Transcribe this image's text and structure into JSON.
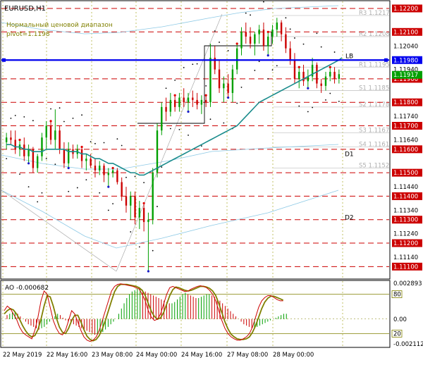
{
  "window": {
    "symbol_title": "EURUSD,H1",
    "indicator_title": "Нормальный ценовой диапазон",
    "pivot_label": "pivot=1.1198"
  },
  "price_axis": {
    "labels": [
      "1.12200",
      "1.12100",
      "1.12040",
      "1.11980",
      "1.11940",
      "1.11900",
      "1.11800",
      "1.11740",
      "1.11700",
      "1.11640",
      "1.11600",
      "1.11500",
      "1.11440",
      "1.11400",
      "1.11340",
      "1.11300",
      "1.11240",
      "1.11200",
      "1.11140",
      "1.11100"
    ],
    "current_price_label": "1.11917",
    "range": [
      1.1105,
      1.1223
    ]
  },
  "levels": [
    {
      "price": 1.122,
      "label": "1.12200"
    },
    {
      "price": 1.121,
      "label": "1.12100"
    },
    {
      "price": 1.119,
      "label": "1.11900"
    },
    {
      "price": 1.118,
      "label": "1.11800"
    },
    {
      "price": 1.117,
      "label": "1.11700"
    },
    {
      "price": 1.116,
      "label": "1.11600"
    },
    {
      "price": 1.115,
      "label": "1.11500"
    },
    {
      "price": 1.114,
      "label": "1.11400"
    },
    {
      "price": 1.113,
      "label": "1.11300"
    },
    {
      "price": 1.112,
      "label": "1.11200"
    },
    {
      "price": 1.111,
      "label": "1.11100"
    }
  ],
  "pivot_line": {
    "price": 1.1198,
    "label": "LB",
    "axis_label": "1.11980"
  },
  "pivot_levels": [
    {
      "name": "R3",
      "label": "R3 1.1217",
      "price": 1.1217
    },
    {
      "name": "R2",
      "label": "R2 1.1208",
      "price": 1.1208
    },
    {
      "name": "R1",
      "label": "R1 1.1195",
      "price": 1.1195
    },
    {
      "name": "S1",
      "label": "S1 1.1185",
      "price": 1.1185
    },
    {
      "name": "S2",
      "label": "S2 1.1178",
      "price": 1.1178
    },
    {
      "name": "S3",
      "label": "S3 1.1167",
      "price": 1.1167
    },
    {
      "name": "S4",
      "label": "S4 1.1161",
      "price": 1.1161
    },
    {
      "name": "S5",
      "label": "S5 1.1152",
      "price": 1.1152
    }
  ],
  "annotations": [
    {
      "label": "D1",
      "price": 1.1158
    },
    {
      "label": "D2",
      "price": 1.1131
    }
  ],
  "time_axis": {
    "labels": [
      "22 May 2019",
      "22 May 16:00",
      "23 May 08:00",
      "24 May 00:00",
      "24 May 16:00",
      "27 May 08:00",
      "28 May 00:00"
    ]
  },
  "oscillator": {
    "title": "AO -0.000682",
    "axis_labels": [
      "0.002893",
      "80",
      "0.00",
      "20",
      "-0.002112"
    ],
    "range": [
      -0.002112,
      0.002893
    ],
    "values": [
      0.0003,
      0.0004,
      0.0005,
      0.0006,
      0.0004,
      0.0002,
      0.0,
      -0.0002,
      -0.0004,
      -0.0005,
      -0.0006,
      -0.0007,
      -0.0008,
      -0.0007,
      -0.0006,
      -0.0004,
      -0.0002,
      0.0,
      0.0002,
      0.0004,
      0.0003,
      0.0001,
      -0.0001,
      -0.0002,
      -0.0003,
      -0.0004,
      -0.0005,
      -0.0006,
      -0.0007,
      -0.0008,
      -0.0009,
      -0.001,
      -0.0011,
      -0.0012,
      -0.0012,
      -0.0011,
      -0.001,
      -0.0008,
      -0.0006,
      -0.0004,
      -0.0002,
      0.0,
      0.0004,
      0.0008,
      0.0012,
      0.0016,
      0.0019,
      0.0021,
      0.0022,
      0.0023,
      0.0023,
      0.0022,
      0.0021,
      0.002,
      0.0019,
      0.0018,
      0.0017,
      0.0016,
      0.0015,
      0.0014,
      0.0013,
      0.0012,
      0.0012,
      0.0013,
      0.0015,
      0.0017,
      0.0019,
      0.002,
      0.0019,
      0.0018,
      0.0017,
      0.0016,
      0.0016,
      0.0017,
      0.0018,
      0.0019,
      0.0019,
      0.0018,
      0.0017,
      0.0016,
      0.0014,
      0.0012,
      0.001,
      0.0008,
      0.0006,
      0.0004,
      0.0002,
      0.0,
      -0.0002,
      -0.0004,
      -0.0005,
      -0.0006,
      -0.0007,
      -0.0007,
      -0.0006,
      -0.0005,
      -0.0004,
      -0.0003,
      -0.0002,
      -0.0001,
      0.0,
      0.0001,
      0.0002,
      0.0003,
      0.0004,
      0.0004
    ],
    "stoch_k": [
      55,
      62,
      58,
      50,
      42,
      30,
      22,
      18,
      15,
      12,
      25,
      45,
      70,
      85,
      80,
      60,
      40,
      28,
      20,
      18,
      25,
      40,
      55,
      50,
      38,
      25,
      15,
      10,
      8,
      10,
      15,
      25,
      40,
      55,
      70,
      85,
      92,
      95,
      96,
      95,
      94,
      93,
      92,
      90,
      88,
      80,
      70,
      55,
      45,
      40,
      42,
      50,
      65,
      80,
      90,
      92,
      90,
      88,
      86,
      84,
      85,
      88,
      90,
      92,
      93,
      92,
      90,
      86,
      80,
      70,
      55,
      40,
      28,
      20,
      15,
      12,
      10,
      10,
      12,
      15,
      20,
      30,
      45,
      60,
      70,
      75,
      78,
      78,
      75,
      72,
      70,
      70
    ],
    "stoch_d": [
      50,
      55,
      58,
      56,
      50,
      42,
      32,
      24,
      18,
      15,
      17,
      26,
      42,
      62,
      78,
      76,
      62,
      44,
      30,
      22,
      20,
      28,
      40,
      48,
      48,
      38,
      26,
      16,
      11,
      9,
      11,
      17,
      27,
      40,
      55,
      70,
      84,
      92,
      95,
      95,
      95,
      94,
      93,
      92,
      90,
      86,
      78,
      66,
      54,
      46,
      42,
      44,
      52,
      65,
      78,
      87,
      91,
      90,
      88,
      86,
      85,
      86,
      88,
      90,
      92,
      92,
      91,
      89,
      85,
      78,
      66,
      52,
      38,
      27,
      19,
      15,
      12,
      11,
      11,
      12,
      15,
      22,
      32,
      45,
      58,
      68,
      74,
      77,
      77,
      75,
      73,
      71
    ]
  },
  "price_series": {
    "candles": [
      [
        1.1163,
        1.1167,
        1.116,
        1.1165
      ],
      [
        1.1165,
        1.1168,
        1.1162,
        1.1164
      ],
      [
        1.1164,
        1.1168,
        1.1158,
        1.116
      ],
      [
        1.116,
        1.1164,
        1.1157,
        1.1162
      ],
      [
        1.1162,
        1.1165,
        1.1155,
        1.1157
      ],
      [
        1.1157,
        1.1162,
        1.1154,
        1.116
      ],
      [
        1.116,
        1.1161,
        1.115,
        1.1152
      ],
      [
        1.1152,
        1.1158,
        1.115,
        1.1157
      ],
      [
        1.1157,
        1.1167,
        1.1155,
        1.1165
      ],
      [
        1.1165,
        1.1172,
        1.116,
        1.117
      ],
      [
        1.117,
        1.1172,
        1.1162,
        1.1164
      ],
      [
        1.1164,
        1.1177,
        1.116,
        1.1168
      ],
      [
        1.1168,
        1.117,
        1.1158,
        1.116
      ],
      [
        1.116,
        1.1163,
        1.1152,
        1.1154
      ],
      [
        1.1154,
        1.1163,
        1.1152,
        1.116
      ],
      [
        1.116,
        1.1162,
        1.1156,
        1.1158
      ],
      [
        1.1158,
        1.1162,
        1.1156,
        1.116
      ],
      [
        1.116,
        1.1161,
        1.1152,
        1.1155
      ],
      [
        1.1155,
        1.1158,
        1.1151,
        1.1156
      ],
      [
        1.1156,
        1.1158,
        1.1152,
        1.1153
      ],
      [
        1.1153,
        1.1156,
        1.1148,
        1.1151
      ],
      [
        1.1151,
        1.1155,
        1.1149,
        1.1153
      ],
      [
        1.1153,
        1.1154,
        1.1146,
        1.1149
      ],
      [
        1.1149,
        1.1152,
        1.1144,
        1.115
      ],
      [
        1.115,
        1.1152,
        1.1148,
        1.1151
      ],
      [
        1.1151,
        1.1152,
        1.1145,
        1.1146
      ],
      [
        1.1146,
        1.1148,
        1.1138,
        1.114
      ],
      [
        1.114,
        1.1144,
        1.1133,
        1.1136
      ],
      [
        1.1136,
        1.1142,
        1.113,
        1.114
      ],
      [
        1.114,
        1.1142,
        1.1128,
        1.1131
      ],
      [
        1.1131,
        1.1138,
        1.1126,
        1.1135
      ],
      [
        1.1135,
        1.1137,
        1.1125,
        1.1129
      ],
      [
        1.1129,
        1.1133,
        1.1108,
        1.113
      ],
      [
        1.113,
        1.1152,
        1.1128,
        1.115
      ],
      [
        1.115,
        1.1171,
        1.1148,
        1.1168
      ],
      [
        1.1168,
        1.118,
        1.1166,
        1.1178
      ],
      [
        1.1178,
        1.1182,
        1.1172,
        1.1176
      ],
      [
        1.1176,
        1.1184,
        1.1174,
        1.1181
      ],
      [
        1.1181,
        1.1183,
        1.1176,
        1.1178
      ],
      [
        1.1178,
        1.1184,
        1.1176,
        1.1182
      ],
      [
        1.1182,
        1.1186,
        1.1178,
        1.118
      ],
      [
        1.118,
        1.1184,
        1.1176,
        1.1182
      ],
      [
        1.1182,
        1.1185,
        1.1178,
        1.1181
      ],
      [
        1.1181,
        1.1184,
        1.1177,
        1.1179
      ],
      [
        1.1179,
        1.1183,
        1.1175,
        1.1181
      ],
      [
        1.1181,
        1.1183,
        1.1178,
        1.118
      ],
      [
        1.118,
        1.1205,
        1.1178,
        1.1199
      ],
      [
        1.1199,
        1.1204,
        1.1192,
        1.1194
      ],
      [
        1.1194,
        1.1198,
        1.1184,
        1.1186
      ],
      [
        1.1186,
        1.1191,
        1.118,
        1.1188
      ],
      [
        1.1188,
        1.1192,
        1.1182,
        1.1184
      ],
      [
        1.1184,
        1.1196,
        1.118,
        1.1194
      ],
      [
        1.1194,
        1.1205,
        1.1192,
        1.1203
      ],
      [
        1.1203,
        1.1212,
        1.12,
        1.121
      ],
      [
        1.121,
        1.1214,
        1.1205,
        1.1208
      ],
      [
        1.1208,
        1.1212,
        1.1203,
        1.1205
      ],
      [
        1.1205,
        1.121,
        1.12,
        1.1209
      ],
      [
        1.1209,
        1.1213,
        1.1205,
        1.1211
      ],
      [
        1.1211,
        1.1214,
        1.1202,
        1.1204
      ],
      [
        1.1204,
        1.121,
        1.12,
        1.1208
      ],
      [
        1.1208,
        1.1213,
        1.1205,
        1.1211
      ],
      [
        1.1211,
        1.1216,
        1.1208,
        1.1214
      ],
      [
        1.1214,
        1.1215,
        1.1206,
        1.1209
      ],
      [
        1.1209,
        1.1212,
        1.1201,
        1.1203
      ],
      [
        1.1203,
        1.1206,
        1.1196,
        1.1198
      ],
      [
        1.1198,
        1.1201,
        1.1188,
        1.119
      ],
      [
        1.119,
        1.1195,
        1.1186,
        1.1193
      ],
      [
        1.1193,
        1.1196,
        1.1187,
        1.1189
      ],
      [
        1.1189,
        1.1194,
        1.1186,
        1.1191
      ],
      [
        1.1191,
        1.1199,
        1.1189,
        1.1196
      ],
      [
        1.1196,
        1.1197,
        1.1186,
        1.1188
      ],
      [
        1.1188,
        1.119,
        1.1184,
        1.1187
      ],
      [
        1.1187,
        1.1193,
        1.1185,
        1.1191
      ],
      [
        1.1191,
        1.1195,
        1.1189,
        1.1193
      ],
      [
        1.1193,
        1.1195,
        1.1188,
        1.119
      ],
      [
        1.119,
        1.1194,
        1.1188,
        1.1192
      ]
    ],
    "ma": [
      1.1162,
      1.1162,
      1.1161,
      1.1161,
      1.116,
      1.116,
      1.1159,
      1.1159,
      1.1159,
      1.116,
      1.116,
      1.116,
      1.116,
      1.116,
      1.1159,
      1.1159,
      1.1159,
      1.1158,
      1.1158,
      1.1157,
      1.1156,
      1.1156,
      1.1155,
      1.1154,
      1.1154,
      1.1153,
      1.1152,
      1.1151,
      1.115,
      1.115,
      1.1149,
      1.1149,
      1.115,
      1.1151,
      1.1152,
      1.1153,
      1.1154,
      1.1155,
      1.1156,
      1.1157,
      1.1158,
      1.1159,
      1.116,
      1.1161,
      1.1162,
      1.1163,
      1.1164,
      1.1165,
      1.1166,
      1.1167,
      1.1168,
      1.1169,
      1.117,
      1.1172,
      1.1174,
      1.1176,
      1.1178,
      1.118,
      1.1181,
      1.1182,
      1.1183,
      1.1184,
      1.1185,
      1.1186,
      1.1187,
      1.1188,
      1.1189,
      1.119,
      1.1191,
      1.1192,
      1.1193,
      1.1194,
      1.1195,
      1.1196,
      1.1197,
      1.1198
    ]
  }
}
